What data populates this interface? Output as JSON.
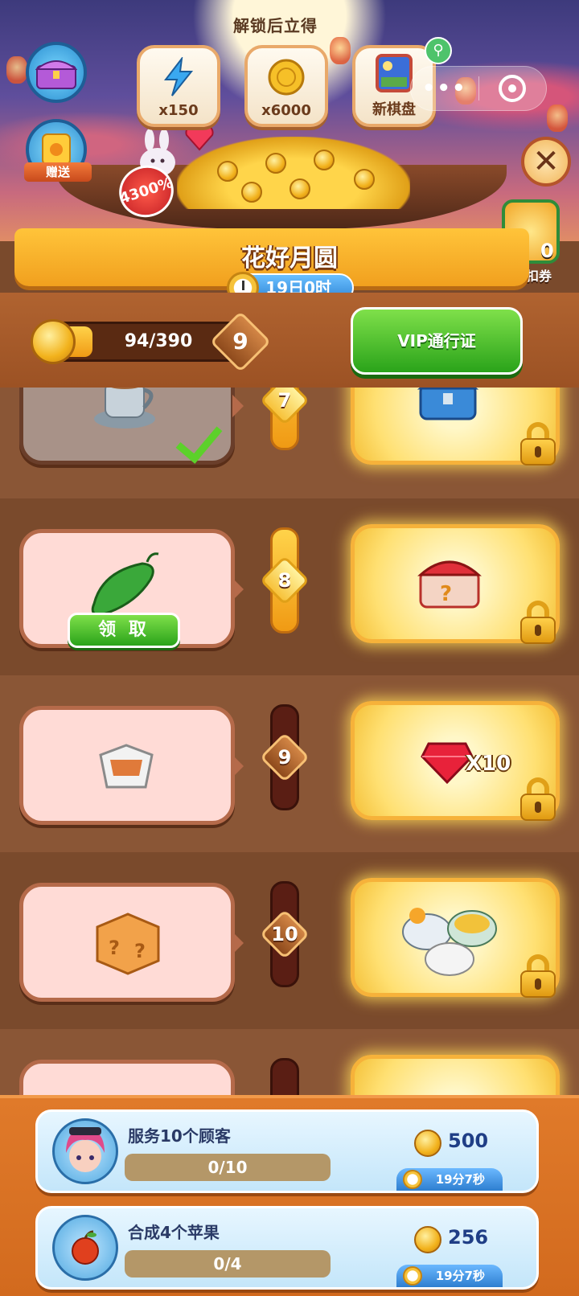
{
  "header": {
    "unlock_label": "解锁后立得",
    "rewards": [
      {
        "icon": "lightning-icon",
        "qty": "x150"
      },
      {
        "icon": "mooncake-coin-icon",
        "qty": "x6000"
      },
      {
        "icon": "new-board-icon",
        "qty": "新棋盘"
      }
    ],
    "gift_label": "赠送",
    "bonus_pct": "4300%",
    "coupon_count": "0",
    "coupon_label": "折扣券"
  },
  "event": {
    "title": "花好月圆",
    "timer": "19日0时"
  },
  "progress": {
    "current": "94/390",
    "fraction": 0.241,
    "level": "9",
    "vip_button": "VIP通行证"
  },
  "tiers": [
    {
      "level": "7",
      "free_item": "tea-cup-icon",
      "free_state": "claimed",
      "vip_item": "blue-chest-icon",
      "vip_qty": ""
    },
    {
      "level": "8",
      "free_item": "cucumber-icon",
      "free_state": "claimable",
      "claim_label": "领 取",
      "vip_item": "red-mystery-chest-icon",
      "vip_qty": ""
    },
    {
      "level": "9",
      "free_item": "takeout-box-icon",
      "free_state": "locked",
      "vip_item": "ruby-gem-icon",
      "vip_qty": "X10"
    },
    {
      "level": "10",
      "free_item": "mystery-cube-icon",
      "free_state": "locked",
      "vip_item": "tea-set-icon",
      "vip_qty": ""
    }
  ],
  "tasks": [
    {
      "title": "服务10个顾客",
      "progress": "0/10",
      "reward": "500",
      "time": "19分7秒",
      "icon": "customer-avatar-icon"
    },
    {
      "title": "合成4个苹果",
      "progress": "0/4",
      "reward": "256",
      "time": "19分7秒",
      "icon": "apple-icon"
    }
  ],
  "colors": {
    "accent_green": "#2aa31a",
    "gold": "#f2b21c",
    "brown_bg": "#7a4a2c"
  }
}
